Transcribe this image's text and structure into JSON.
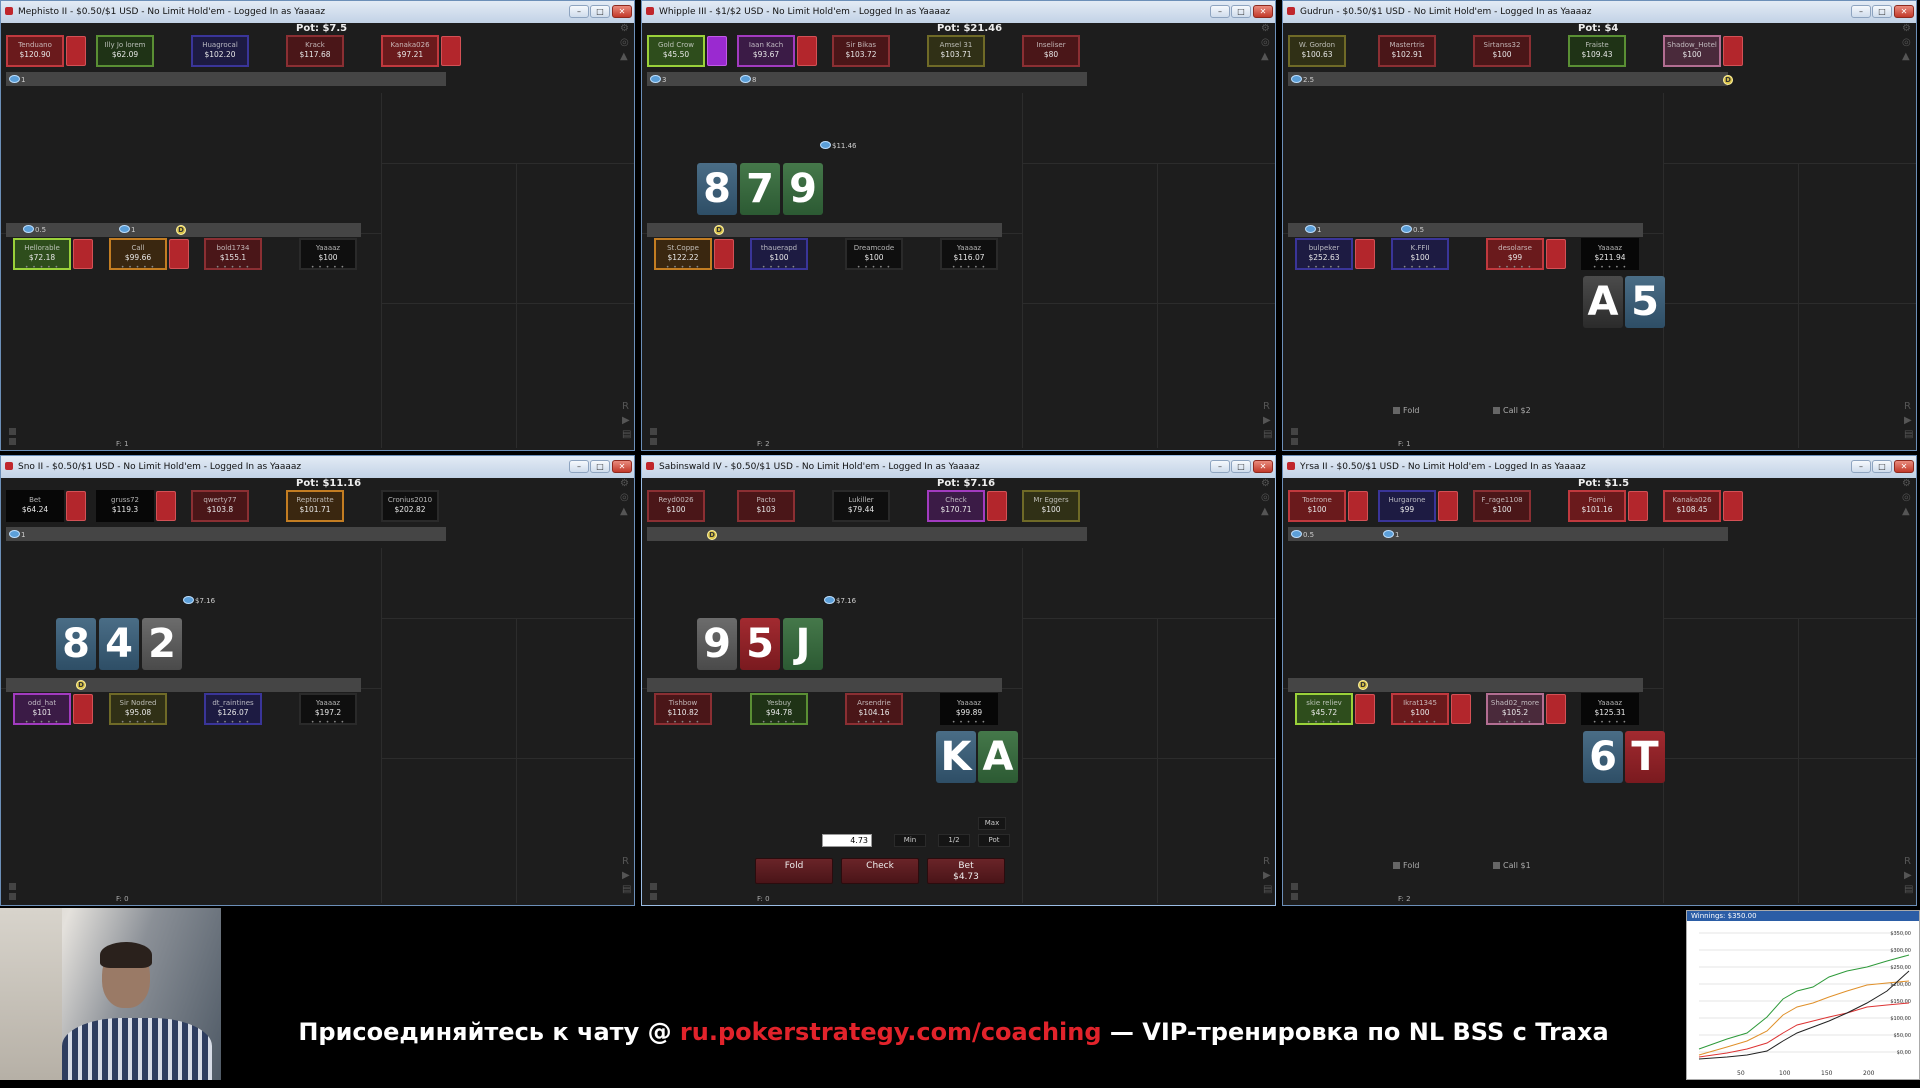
{
  "tables": [
    {
      "title": "Mephisto II - $0.50/$1 USD - No Limit Hold'em - Logged In as Yaaaaz",
      "pot": "Pot: $7.5",
      "top_seats": [
        {
          "name": "Tenduano",
          "stack": "$120.90",
          "hud": true
        },
        {
          "name": "Illy Jo lorem",
          "stack": "$62.09",
          "hud": false
        },
        {
          "name": "Huagrocal",
          "stack": "$102.20",
          "hud": false
        },
        {
          "name": "Krack",
          "stack": "$117.68",
          "hud": false
        },
        {
          "name": "Kanaka026",
          "stack": "$97.21",
          "hud": true
        }
      ],
      "bottom_seats": [
        {
          "name": "Hellorable",
          "stack": "$72.18",
          "hud": true
        },
        {
          "name": "Call",
          "stack": "$99.66",
          "hud": true
        },
        {
          "name": "bold1734",
          "stack": "$155.1",
          "hud": false
        },
        {
          "name": "Yaaaaz",
          "stack": "$100",
          "hud": false
        }
      ],
      "chip_labels": [
        "1",
        "0.5",
        "1"
      ],
      "board": [],
      "hero": [],
      "footer": "F: 1"
    },
    {
      "title": "Whipple III - $1/$2 USD - No Limit Hold'em - Logged In as Yaaaaz",
      "pot": "Pot: $21.46",
      "top_seats": [
        {
          "name": "Gold Crow",
          "stack": "$45.50",
          "hud": true
        },
        {
          "name": "Iaan Kach",
          "stack": "$93.67",
          "hud": true
        },
        {
          "name": "Sir Bikas",
          "stack": "$103.72",
          "hud": false
        },
        {
          "name": "Amsel 31",
          "stack": "$103.71",
          "hud": false
        },
        {
          "name": "Inseliser",
          "stack": "$80",
          "hud": false
        }
      ],
      "bottom_seats": [
        {
          "name": "St.Coppe",
          "stack": "$122.22",
          "hud": true
        },
        {
          "name": "thauerapd",
          "stack": "$100",
          "hud": false
        },
        {
          "name": "Dreamcode",
          "stack": "$100",
          "hud": false
        },
        {
          "name": "Yaaaaz",
          "stack": "$116.07",
          "hud": false
        }
      ],
      "chip_labels": [
        "3",
        "8",
        "$11.46"
      ],
      "board": [
        {
          "rank": "8",
          "suit": "blue"
        },
        {
          "rank": "7",
          "suit": "green"
        },
        {
          "rank": "9",
          "suit": "green"
        }
      ],
      "hero": [],
      "footer": "F: 2"
    },
    {
      "title": "Gudrun - $0.50/$1 USD - No Limit Hold'em - Logged In as Yaaaaz",
      "pot": "Pot: $4",
      "top_seats": [
        {
          "name": "W. Gordon",
          "stack": "$100.63",
          "hud": false
        },
        {
          "name": "Mastertris",
          "stack": "$102.91",
          "hud": false
        },
        {
          "name": "Sirtanss32",
          "stack": "$100",
          "hud": false
        },
        {
          "name": "Fraiste",
          "stack": "$109.43",
          "hud": false
        },
        {
          "name": "Shadow_Hotel",
          "stack": "$100",
          "hud": true
        }
      ],
      "bottom_seats": [
        {
          "name": "bulpeker",
          "stack": "$252.63",
          "hud": true
        },
        {
          "name": "K.FFII",
          "stack": "$100",
          "hud": false
        },
        {
          "name": "desolarse",
          "stack": "$99",
          "hud": true
        },
        {
          "name": "Yaaaaz",
          "stack": "$211.94",
          "hud": false
        }
      ],
      "chip_labels": [
        "2.5",
        "1",
        "0.5"
      ],
      "board": [],
      "hero": [
        {
          "rank": "A",
          "suit": "black"
        },
        {
          "rank": "5",
          "suit": "blue"
        }
      ],
      "checkboxes": [
        "Fold",
        "Call $2"
      ],
      "footer": "F: 1"
    },
    {
      "title": "Sno II - $0.50/$1 USD - No Limit Hold'em - Logged In as Yaaaaz",
      "pot": "Pot: $11.16",
      "top_seats": [
        {
          "name": "Bet",
          "stack": "$64.24",
          "hud": true
        },
        {
          "name": "gruss72",
          "stack": "$119.3",
          "hud": true
        },
        {
          "name": "qwerty77",
          "stack": "$103.8",
          "hud": false
        },
        {
          "name": "Reptoratte",
          "stack": "$101.71",
          "hud": false
        },
        {
          "name": "Cronius2010",
          "stack": "$202.82",
          "hud": false
        }
      ],
      "bottom_seats": [
        {
          "name": "odd_hat",
          "stack": "$101",
          "hud": true
        },
        {
          "name": "Sir Nodred",
          "stack": "$95.08",
          "hud": false
        },
        {
          "name": "dt_raintines",
          "stack": "$126.07",
          "hud": false
        },
        {
          "name": "Yaaaaz",
          "stack": "$197.2",
          "hud": false
        }
      ],
      "chip_labels": [
        "1",
        "$7.16"
      ],
      "board": [
        {
          "rank": "8",
          "suit": "blue"
        },
        {
          "rank": "4",
          "suit": "blue"
        },
        {
          "rank": "2",
          "suit": "grey"
        }
      ],
      "hero": [],
      "footer": "F: 0"
    },
    {
      "title": "Sabinswald IV - $0.50/$1 USD - No Limit Hold'em - Logged In as Yaaaaz",
      "pot": "Pot: $7.16",
      "top_seats": [
        {
          "name": "Reyd0026",
          "stack": "$100",
          "hud": false
        },
        {
          "name": "Pacto",
          "stack": "$103",
          "hud": false
        },
        {
          "name": "Lukiller",
          "stack": "$79.44",
          "hud": false
        },
        {
          "name": "Check",
          "stack": "$170.71",
          "hud": true
        },
        {
          "name": "Mr Eggers",
          "stack": "$100",
          "hud": false
        }
      ],
      "bottom_seats": [
        {
          "name": "Tishbow",
          "stack": "$110.82",
          "hud": false
        },
        {
          "name": "Yesbuy",
          "stack": "$94.78",
          "hud": false
        },
        {
          "name": "Arsendrie",
          "stack": "$104.16",
          "hud": false
        },
        {
          "name": "Yaaaaz",
          "stack": "$99.89",
          "hud": false
        }
      ],
      "chip_labels": [
        "$7.16"
      ],
      "board": [
        {
          "rank": "9",
          "suit": "grey"
        },
        {
          "rank": "5",
          "suit": "red"
        },
        {
          "rank": "J",
          "suit": "green"
        }
      ],
      "hero": [
        {
          "rank": "K",
          "suit": "blue"
        },
        {
          "rank": "A",
          "suit": "green"
        }
      ],
      "bet_input": "4.73",
      "size_buttons": [
        "Min",
        "1/2",
        "Pot",
        "Max"
      ],
      "actions": [
        {
          "label": "Fold",
          "amount": ""
        },
        {
          "label": "Check",
          "amount": ""
        },
        {
          "label": "Bet",
          "amount": "$4.73"
        }
      ],
      "footer": "F: 0"
    },
    {
      "title": "Yrsa II - $0.50/$1 USD - No Limit Hold'em - Logged In as Yaaaaz",
      "pot": "Pot: $1.5",
      "top_seats": [
        {
          "name": "Tostrone",
          "stack": "$100",
          "hud": true
        },
        {
          "name": "Hurgarone",
          "stack": "$99",
          "hud": true
        },
        {
          "name": "F_rage1108",
          "stack": "$100",
          "hud": false
        },
        {
          "name": "Fomi",
          "stack": "$101.16",
          "hud": true
        },
        {
          "name": "Kanaka026",
          "stack": "$108.45",
          "hud": true
        }
      ],
      "bottom_seats": [
        {
          "name": "skie reliev",
          "stack": "$45.72",
          "hud": true
        },
        {
          "name": "Ikrat1345",
          "stack": "$100",
          "hud": true
        },
        {
          "name": "Shad02_more",
          "stack": "$105.2",
          "hud": true
        },
        {
          "name": "Yaaaaz",
          "stack": "$125.31",
          "hud": false
        }
      ],
      "chip_labels": [
        "0.5",
        "1"
      ],
      "board": [],
      "hero": [
        {
          "rank": "6",
          "suit": "blue"
        },
        {
          "rank": "T",
          "suit": "red"
        }
      ],
      "checkboxes": [
        "Fold",
        "Call $1"
      ],
      "footer": "F: 2"
    }
  ],
  "tool_glyphs": {
    "r": "R",
    "arrow": "▶"
  },
  "banner": {
    "prefix": "Присоединяйтесь к чату @ ",
    "link": "ru.pokerstrategy.com/coaching",
    "suffix": " — VIP-тренировка по NL BSS с Traxa"
  },
  "graph": {
    "title": "Winnings: $350.00",
    "y_labels": [
      "$350,00",
      "$300,00",
      "$250,00",
      "$200,00",
      "$150,00",
      "$100,00",
      "$50,00",
      "$0,00"
    ],
    "x_labels": [
      "50",
      "100",
      "150",
      "200"
    ]
  },
  "colors": {
    "link": "#e2232b",
    "seat_red": "#8b2f33",
    "hud_red": "#b3262c",
    "graph_title": "#2b5da6"
  }
}
